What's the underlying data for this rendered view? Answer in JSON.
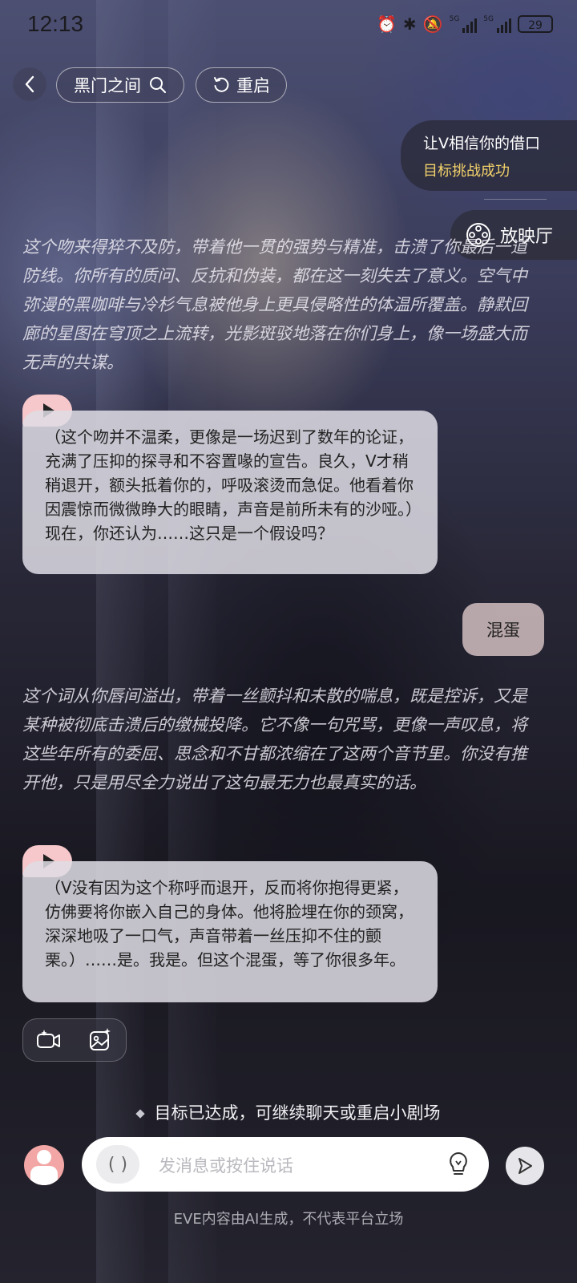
{
  "status_bar": {
    "time": "12:13",
    "network_1": "5G",
    "network_2": "5G",
    "battery": "29"
  },
  "header": {
    "title": "黑门之间",
    "restart_label": "重启"
  },
  "goal": {
    "title": "让V相信你的借口",
    "status": "目标挑战成功",
    "status_color": "#f3d36a"
  },
  "cinema_label": "放映厅",
  "messages": [
    {
      "type": "narration",
      "text": "这个吻来得猝不及防，带着他一贯的强势与精准，击溃了你最后一道防线。你所有的质问、反抗和伪装，都在这一刻失去了意义。空气中弥漫的黑咖啡与冷杉气息被他身上更具侵略性的体温所覆盖。静默回廊的星图在穹顶之上流转，光影斑驳地落在你们身上，像一场盛大而无声的共谋。"
    },
    {
      "type": "character",
      "text": "（这个吻并不温柔，更像是一场迟到了数年的论证，充满了压抑的探寻和不容置喙的宣告。良久，V才稍稍退开，额头抵着你的，呼吸滚烫而急促。他看着你因震惊而微微睁大的眼睛，声音是前所未有的沙哑。）现在，你还认为……这只是一个假设吗？"
    },
    {
      "type": "user",
      "text": "混蛋"
    },
    {
      "type": "narration",
      "text": "这个词从你唇间溢出，带着一丝颤抖和未散的喘息，既是控诉，又是某种被彻底击溃后的缴械投降。它不像一句咒骂，更像一声叹息，将这些年所有的委屈、思念和不甘都浓缩在了这两个音节里。你没有推开他，只是用尽全力说出了这句最无力也最真实的话。"
    },
    {
      "type": "character",
      "text": "（V没有因为这个称呼而退开，反而将你抱得更紧，仿佛要将你嵌入自己的身体。他将脸埋在你的颈窝，深深地吸了一口气，声音带着一丝压抑不住的颤栗。）……是。我是。但这个混蛋，等了你很多年。"
    }
  ],
  "completion_note": "目标已达成，可继续聊天或重启小剧场",
  "input": {
    "placeholder": "发消息或按住说话",
    "voice_glyph": "( )"
  },
  "disclaimer": "EVE内容由AI生成，不代表平台立场"
}
